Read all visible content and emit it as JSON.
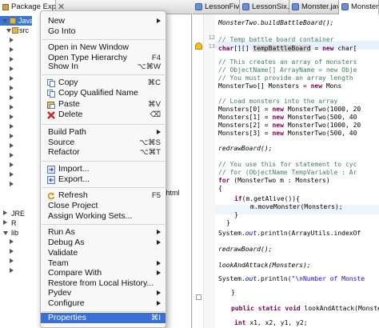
{
  "explorer": {
    "tab_title": "Package Explorer",
    "tree": {
      "project": "Java C",
      "src": "src",
      "jre": "JRE",
      "ref": "R",
      "lib": "lib",
      "html_file": ".html"
    }
  },
  "context_menu": {
    "items": [
      {
        "label": "New",
        "shortcut": "",
        "submenu": true
      },
      {
        "label": "Go Into",
        "shortcut": "",
        "submenu": false
      },
      {
        "label": "Open in New Window",
        "shortcut": "",
        "submenu": false
      },
      {
        "label": "Open Type Hierarchy",
        "shortcut": "F4",
        "submenu": false
      },
      {
        "label": "Show In",
        "shortcut": "⌥⌘W",
        "submenu": true
      },
      {
        "label": "Copy",
        "shortcut": "⌘C",
        "submenu": false
      },
      {
        "label": "Copy Qualified Name",
        "shortcut": "",
        "submenu": false
      },
      {
        "label": "Paste",
        "shortcut": "⌘V",
        "submenu": false
      },
      {
        "label": "Delete",
        "shortcut": "⌫",
        "submenu": false
      },
      {
        "label": "Build Path",
        "shortcut": "",
        "submenu": true
      },
      {
        "label": "Source",
        "shortcut": "⌥⌘S",
        "submenu": true
      },
      {
        "label": "Refactor",
        "shortcut": "⌥⌘T",
        "submenu": true
      },
      {
        "label": "Import...",
        "shortcut": "",
        "submenu": false
      },
      {
        "label": "Export...",
        "shortcut": "",
        "submenu": false
      },
      {
        "label": "Refresh",
        "shortcut": "F5",
        "submenu": false
      },
      {
        "label": "Close Project",
        "shortcut": "",
        "submenu": false
      },
      {
        "label": "Assign Working Sets...",
        "shortcut": "",
        "submenu": false
      },
      {
        "label": "Run As",
        "shortcut": "",
        "submenu": true
      },
      {
        "label": "Debug As",
        "shortcut": "",
        "submenu": true
      },
      {
        "label": "Validate",
        "shortcut": "",
        "submenu": false
      },
      {
        "label": "Team",
        "shortcut": "",
        "submenu": true
      },
      {
        "label": "Compare With",
        "shortcut": "",
        "submenu": true
      },
      {
        "label": "Restore from Local History...",
        "shortcut": "",
        "submenu": false
      },
      {
        "label": "Pydev",
        "shortcut": "",
        "submenu": true
      },
      {
        "label": "Configure",
        "shortcut": "",
        "submenu": true
      },
      {
        "label": "Properties",
        "shortcut": "⌘I",
        "submenu": false
      }
    ]
  },
  "editor": {
    "tabs": [
      "LessonFive.java",
      "LessonSix.java",
      "Monster.java",
      "Monster"
    ],
    "line_numbers": [
      "12",
      "13"
    ],
    "code": {
      "l1": "MonsterTwo.buildBattleBoard();",
      "l2": "// Temp battle board container",
      "l3a": "char",
      "l3b": "[][] ",
      "l3c": "tempBattleBoard",
      "l3d": " = ",
      "l3e": "new",
      "l3f": " char[",
      "l4": "// This creates an array of monsters",
      "l5": "// ObjectName[] ArrayName = new Obje",
      "l6": "// You must provide an array length",
      "l7a": "MonsterTwo[] Monsters = ",
      "l7b": "new",
      "l7c": " Mons",
      "l8": "// Load monsters into the array",
      "l9a": "Monsters[0] = ",
      "l9b": "new",
      "l9c": " MonsterTwo(1000, 20",
      "l10a": "Monsters[1] = ",
      "l10b": "new",
      "l10c": " MonsterTwo(500, 40",
      "l11a": "Monsters[2] = ",
      "l11b": "new",
      "l11c": " MonsterTwo(1000, 20",
      "l12a": "Monsters[3] = ",
      "l12b": "new",
      "l12c": " MonsterTwo(500, 40",
      "l13": "redrawBoard();",
      "l14": "// You use this for statement to cyc",
      "l15": "// for (ObjectName TempVariable : Ar",
      "l16a": "for",
      "l16b": " (MonsterTwo m : Monsters)",
      "l17": "{",
      "l18a": "if",
      "l18b": "(m.getAlive()){",
      "l19": "m.moveMonster(Monsters);",
      "l20": "}",
      "l21": "}",
      "l22a": "System.",
      "l22b": "out",
      "l22c": ".println(ArrayUtils.indexOf",
      "l23": "redrawBoard();",
      "l24": "lookAndAttack(Monsters);",
      "l25a": "System.",
      "l25b": "out",
      "l25c": ".println(",
      "l25d": "\"\\nNumber of Monste",
      "l26": "}",
      "l27a": "public static void",
      "l27b": " lookAndAttack(Monste",
      "l28a": "int",
      "l28b": " x1, x2, y1, y2;"
    }
  }
}
